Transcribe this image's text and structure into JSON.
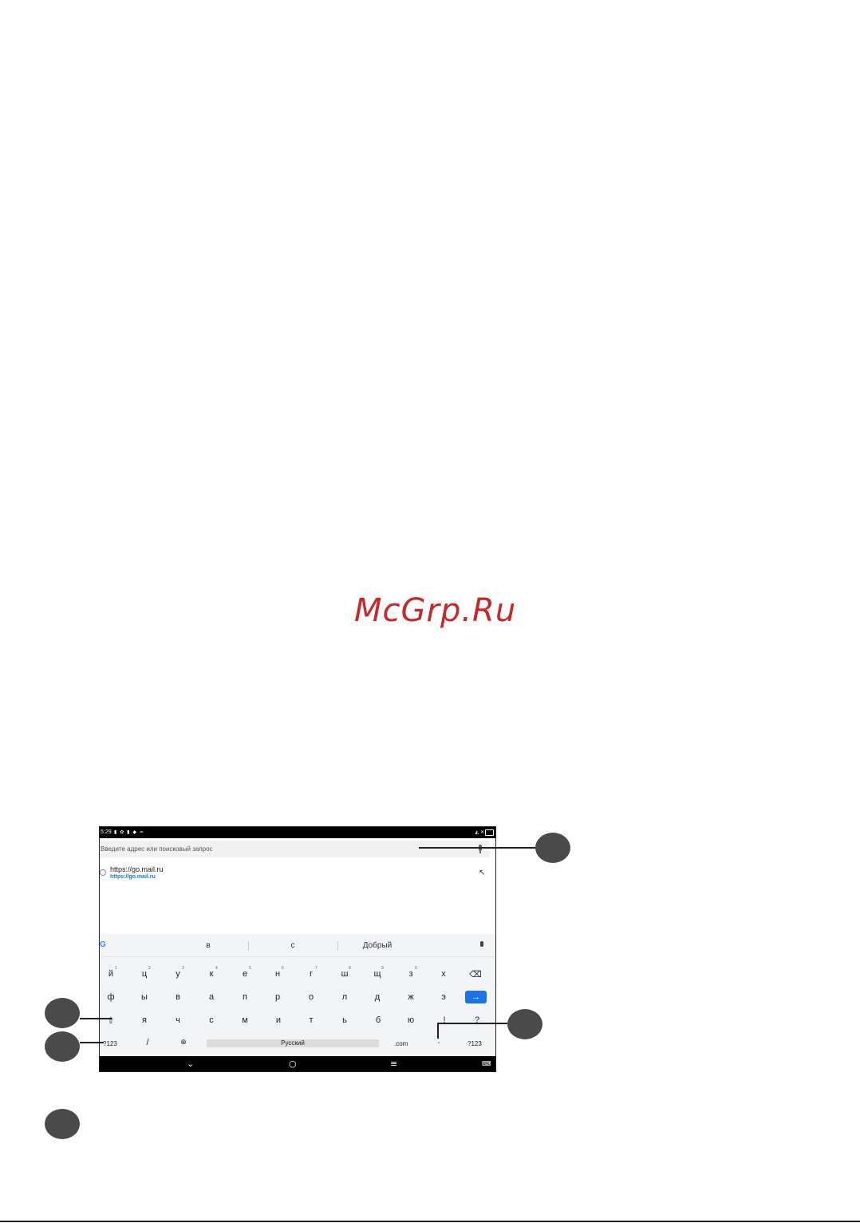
{
  "watermark": "McGrp.Ru",
  "screenshot": {
    "status": {
      "time": "5:29",
      "left_icons": "▮ ✿ ▮ ◆ ≈",
      "right_icons": "◭ ✕",
      "battery": "31"
    },
    "address_bar": {
      "placeholder": "Введите адрес или поисковый запрос"
    },
    "suggestion": {
      "title": "https://go.mail.ru",
      "url": "https://go.mail.ru",
      "arrow": "↖"
    },
    "keyboard": {
      "suggestions": [
        "в",
        "с",
        "Добрый"
      ],
      "google_logo": "G",
      "row1": [
        {
          "k": "й",
          "n": "1"
        },
        {
          "k": "ц",
          "n": "2"
        },
        {
          "k": "у",
          "n": "3"
        },
        {
          "k": "к",
          "n": "4"
        },
        {
          "k": "е",
          "n": "5"
        },
        {
          "k": "н",
          "n": "6"
        },
        {
          "k": "г",
          "n": "7"
        },
        {
          "k": "ш",
          "n": "8"
        },
        {
          "k": "щ",
          "n": "9"
        },
        {
          "k": "з",
          "n": "0"
        },
        {
          "k": "х",
          "n": ""
        }
      ],
      "backspace": "⌫",
      "row2": [
        "ф",
        "ы",
        "в",
        "а",
        "п",
        "р",
        "о",
        "л",
        "д",
        "ж",
        "э"
      ],
      "enter": "→",
      "row3": [
        "я",
        "ч",
        "с",
        "м",
        "и",
        "т",
        "ь",
        "б",
        "ю",
        "!",
        "?"
      ],
      "shift": "⇧",
      "bottom": {
        "sym_left": "?123",
        "slash": "/",
        "globe": "⊕",
        "space": "Русский",
        "dotcom": ".com",
        "dot": "·",
        "sym_right": "?123"
      }
    },
    "nav": {
      "back": "⌄",
      "home": "○",
      "recents": "≡",
      "keyboard": "⌨"
    }
  }
}
